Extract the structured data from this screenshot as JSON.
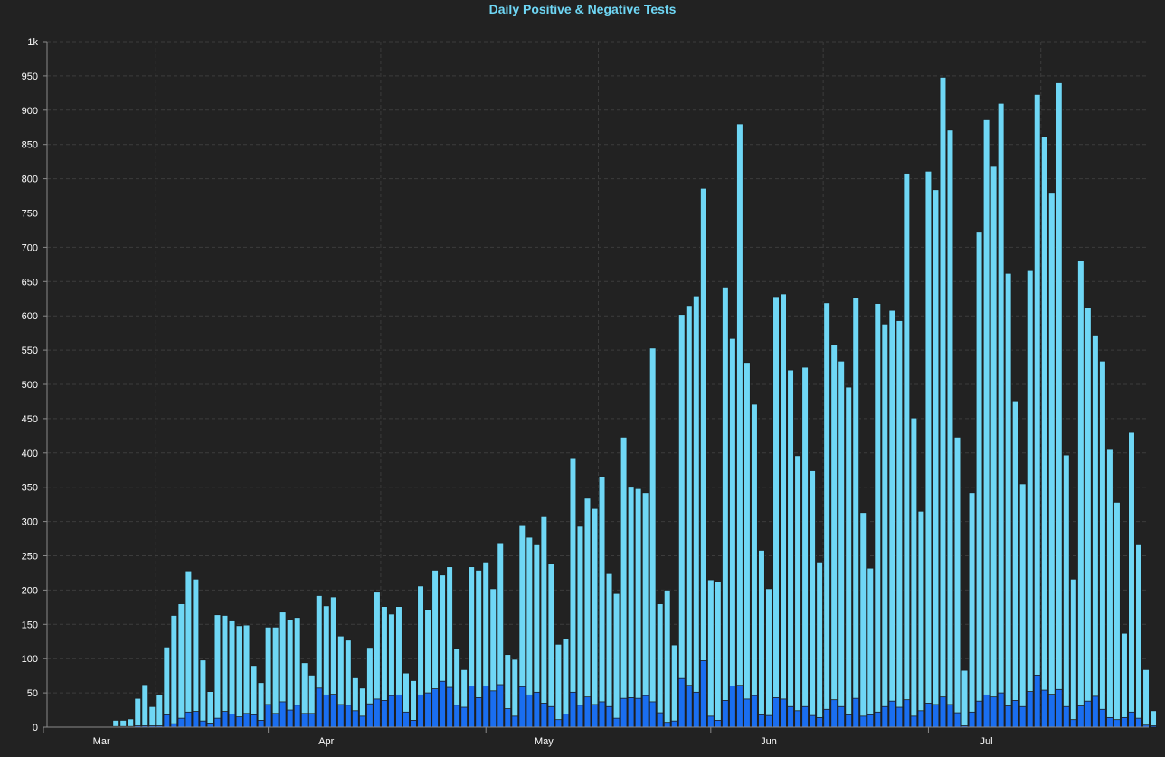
{
  "chart_data": {
    "type": "bar",
    "stacked": true,
    "title": "Daily Positive & Negative Tests",
    "xlabel": "",
    "ylabel": "",
    "ylim": [
      0,
      1000
    ],
    "y_ticks": [
      "0",
      "50",
      "100",
      "150",
      "200",
      "250",
      "300",
      "350",
      "400",
      "450",
      "500",
      "550",
      "600",
      "650",
      "700",
      "750",
      "800",
      "850",
      "900",
      "950",
      "1k"
    ],
    "y_tick_values": [
      0,
      50,
      100,
      150,
      200,
      250,
      300,
      350,
      400,
      450,
      500,
      550,
      600,
      650,
      700,
      750,
      800,
      850,
      900,
      950,
      1000
    ],
    "x_ticks": [
      {
        "label": "Mar",
        "index": 15
      },
      {
        "label": "Apr",
        "index": 46
      },
      {
        "label": "May",
        "index": 76
      },
      {
        "label": "Jun",
        "index": 107
      },
      {
        "label": "Jul",
        "index": 137
      }
    ],
    "grid": true,
    "legend": "none",
    "colors": {
      "background": "#222222",
      "total_bar": "#6fd7f5",
      "positive_bar": "#1a6ef0",
      "bar_outline": "#1e1e1e",
      "grid": "#3c3c3c",
      "axis": "#8a8a8a",
      "tick_text": "#ffffff",
      "title": "#6fd7f5"
    },
    "series": [
      {
        "values": [
          0,
          0,
          0,
          0,
          0,
          0,
          0,
          0,
          0,
          10,
          10,
          12,
          42,
          62,
          30,
          47,
          117,
          163,
          180,
          228,
          216,
          98,
          52,
          164,
          163,
          155,
          148,
          149,
          90,
          65,
          146,
          146,
          168,
          157,
          160,
          94,
          76,
          192,
          177,
          190,
          133,
          127,
          72,
          57,
          115,
          197,
          176,
          165,
          176,
          79,
          68,
          206,
          172,
          229,
          222,
          234,
          114,
          84,
          234,
          229,
          241,
          202,
          269,
          106,
          99,
          294,
          277,
          266,
          307,
          238,
          121,
          129,
          393,
          293,
          334,
          319,
          366,
          224,
          195,
          423,
          350,
          348,
          342,
          553,
          180,
          200,
          120,
          602,
          615,
          629,
          786,
          215,
          212,
          642,
          567,
          880,
          532,
          471,
          258,
          202,
          628,
          632,
          521,
          396,
          525,
          374,
          241,
          619,
          558,
          534,
          496,
          627,
          313,
          232,
          618,
          588,
          608,
          593,
          808,
          451,
          315,
          811,
          784,
          948,
          871,
          423,
          83,
          342,
          722,
          886,
          818,
          910,
          662,
          476,
          355,
          666,
          923,
          862,
          780,
          940,
          397,
          216,
          680,
          612,
          572,
          534,
          405,
          328,
          137,
          430,
          266,
          84,
          24
        ]
      },
      {
        "values": [
          0,
          0,
          0,
          0,
          0,
          0,
          0,
          0,
          0,
          1,
          1,
          1,
          2,
          2,
          2,
          2,
          18,
          5,
          13,
          22,
          23,
          9,
          6,
          13,
          23,
          19,
          15,
          20,
          18,
          10,
          33,
          20,
          37,
          25,
          32,
          20,
          20,
          57,
          47,
          48,
          33,
          32,
          24,
          16,
          34,
          41,
          39,
          46,
          47,
          22,
          10,
          47,
          50,
          56,
          67,
          58,
          32,
          29,
          60,
          43,
          60,
          53,
          62,
          27,
          16,
          59,
          47,
          51,
          35,
          30,
          11,
          19,
          51,
          32,
          44,
          33,
          37,
          30,
          13,
          42,
          43,
          42,
          46,
          37,
          21,
          7,
          9,
          71,
          61,
          51,
          97,
          16,
          10,
          39,
          60,
          61,
          41,
          46,
          18,
          17,
          43,
          41,
          30,
          24,
          30,
          17,
          14,
          26,
          40,
          30,
          18,
          42,
          16,
          18,
          22,
          30,
          38,
          29,
          40,
          16,
          24,
          35,
          33,
          44,
          33,
          21,
          2,
          22,
          38,
          47,
          44,
          50,
          31,
          39,
          30,
          52,
          76,
          54,
          48,
          55,
          30,
          11,
          31,
          38,
          45,
          26,
          14,
          11,
          14,
          22,
          13,
          3,
          2
        ]
      }
    ]
  }
}
